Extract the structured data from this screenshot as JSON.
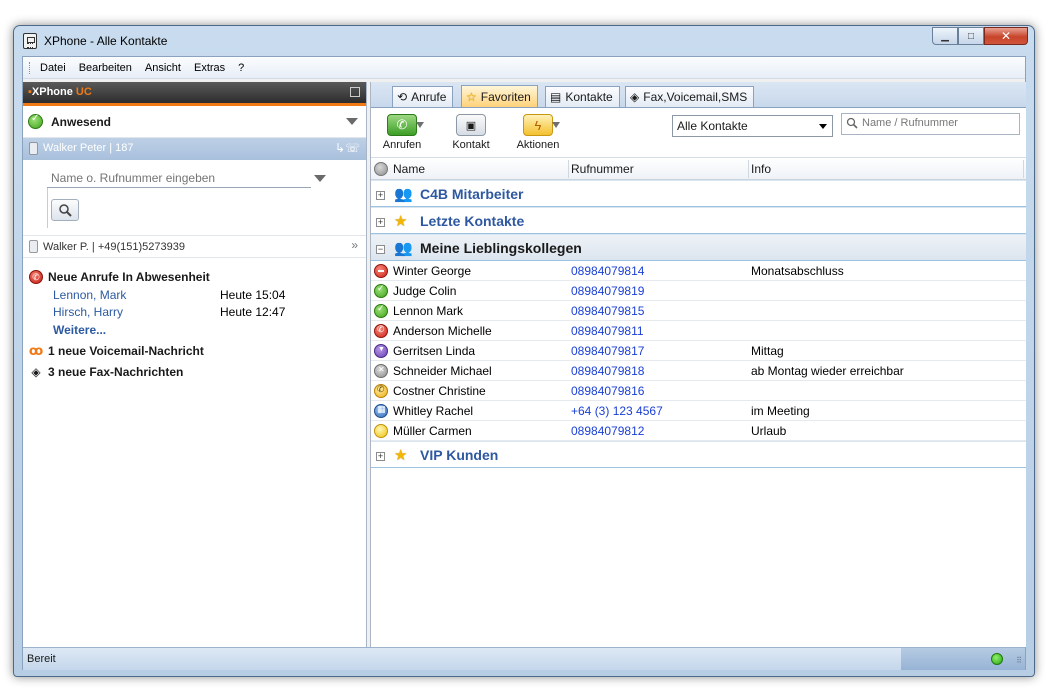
{
  "window": {
    "title": "XPhone - Alle Kontakte",
    "app_icon": "phone-icon"
  },
  "menu": {
    "items": [
      "Datei",
      "Bearbeiten",
      "Ansicht",
      "Extras",
      "?"
    ]
  },
  "brand": {
    "name": "XPhone",
    "suffix": "UC",
    "accent": "#f07a14"
  },
  "presence": {
    "label": "Anwesend",
    "color": "#3ea31a"
  },
  "user": {
    "line_label": "Walker Peter  | 187"
  },
  "dial": {
    "placeholder": "Name o. Rufnummer eingeben"
  },
  "line": {
    "label": "Walker P. | +49(151)5273939"
  },
  "events": {
    "missed_title": "Neue Anrufe In Abwesenheit",
    "missed": [
      {
        "name": "Lennon, Mark",
        "time": "Heute 15:04"
      },
      {
        "name": "Hirsch, Harry",
        "time": "Heute 12:47"
      }
    ],
    "more": "Weitere...",
    "voicemail": "1 neue Voicemail-Nachricht",
    "fax": "3 neue Fax-Nachrichten"
  },
  "tabs": [
    {
      "label": "Anrufe",
      "icon": "history-icon",
      "active": false
    },
    {
      "label": "Favoriten",
      "icon": "star-icon",
      "active": true
    },
    {
      "label": "Kontakte",
      "icon": "contact-card-icon",
      "active": false
    },
    {
      "label": "Fax,Voicemail,SMS",
      "icon": "fax-icon",
      "active": false
    }
  ],
  "toolbar": {
    "call_label": "Anrufen",
    "contact_label": "Kontakt",
    "actions_label": "Aktionen",
    "filter_value": "Alle Kontakte",
    "search_placeholder": "Name / Rufnummer"
  },
  "columns": {
    "name": "Name",
    "number": "Rufnummer",
    "info": "Info"
  },
  "groups": {
    "g1": {
      "name": "C4B Mitarbeiter",
      "expanded": false
    },
    "g2": {
      "name": "Letzte Kontakte",
      "expanded": false
    },
    "g3": {
      "name": "Meine Lieblingskollegen",
      "expanded": true
    },
    "g4": {
      "name": "VIP Kunden",
      "expanded": false
    }
  },
  "contacts": [
    {
      "name": "Winter George",
      "number": "08984079814",
      "info": "Monatsabschluss",
      "presence": "busy"
    },
    {
      "name": "Judge Colin",
      "number": "08984079819",
      "info": "",
      "presence": "available"
    },
    {
      "name": "Lennon Mark",
      "number": "08984079815",
      "info": "",
      "presence": "available"
    },
    {
      "name": "Anderson Michelle",
      "number": "08984079811",
      "info": "",
      "presence": "on-phone"
    },
    {
      "name": "Gerritsen Linda",
      "number": "08984079817",
      "info": "Mittag",
      "presence": "lunch"
    },
    {
      "name": "Schneider Michael",
      "number": "08984079818",
      "info": "ab Montag wieder erreichbar",
      "presence": "offline"
    },
    {
      "name": "Costner Christine",
      "number": "08984079816",
      "info": "",
      "presence": "ringing"
    },
    {
      "name": "Whitley Rachel",
      "number": "+64 (3) 123 4567",
      "info": "im Meeting",
      "presence": "meeting"
    },
    {
      "name": "Müller Carmen",
      "number": "08984079812",
      "info": "Urlaub",
      "presence": "vacation"
    }
  ],
  "statusbar": {
    "text": "Bereit",
    "connection_color": "#2aa414"
  }
}
